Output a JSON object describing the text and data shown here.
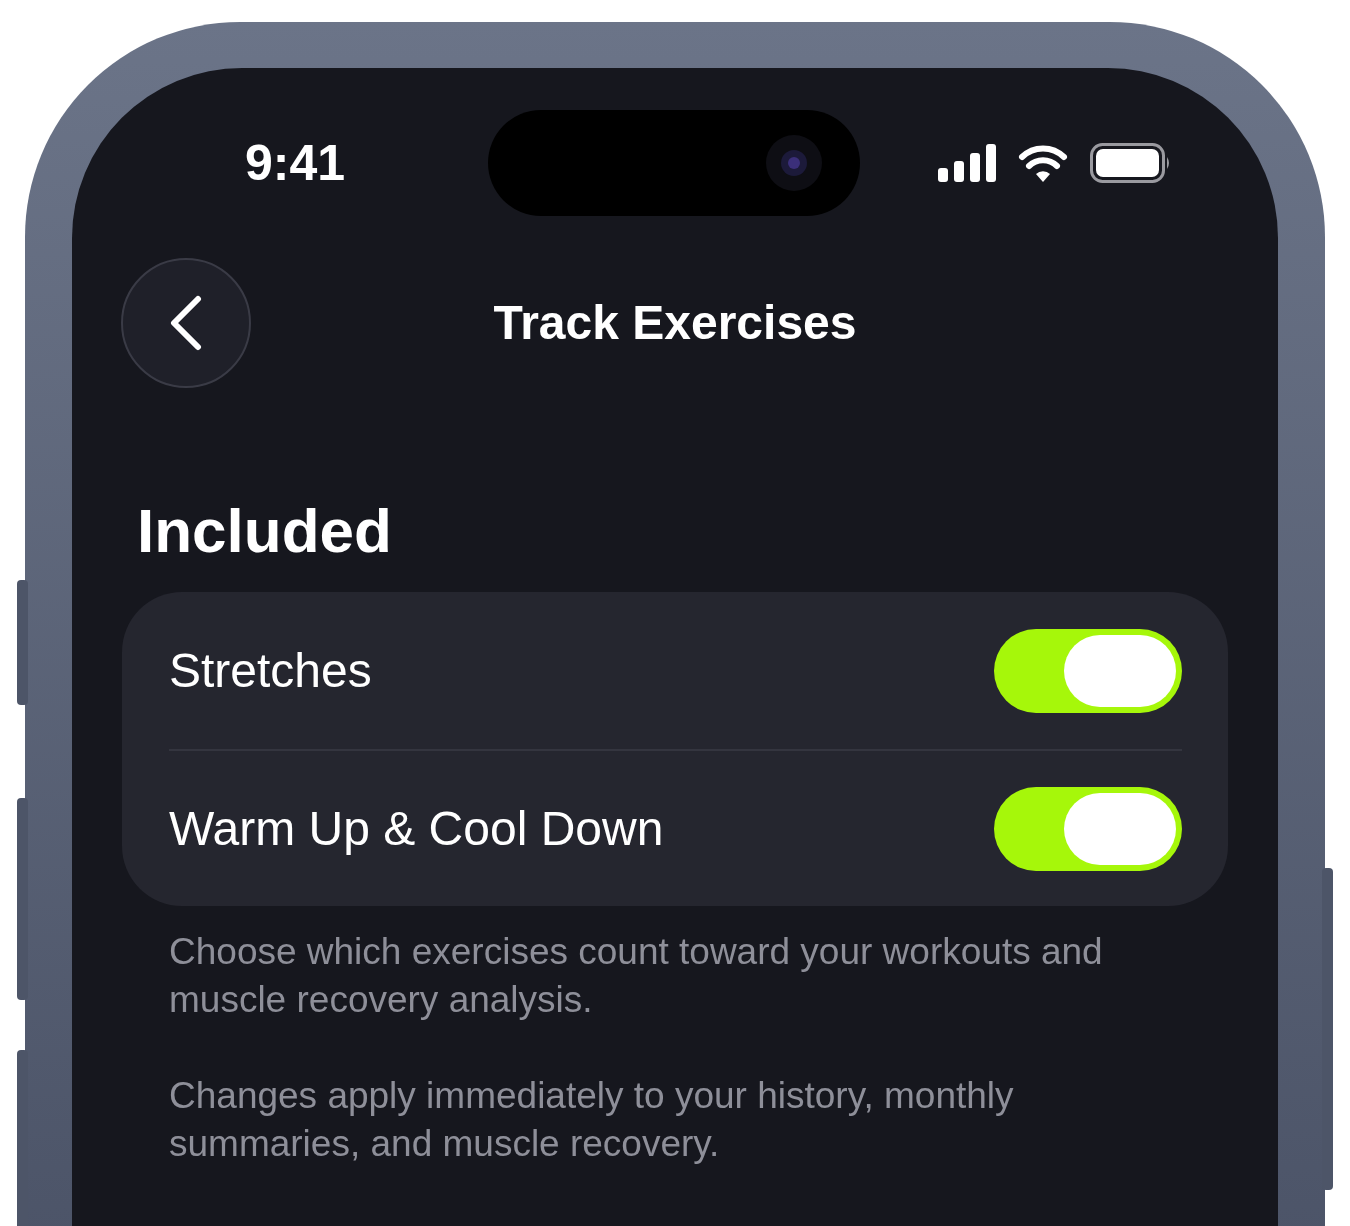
{
  "status_bar": {
    "time": "9:41"
  },
  "nav": {
    "title": "Track Exercises"
  },
  "section": {
    "title": "Included",
    "rows": [
      {
        "label": "Stretches",
        "on": true
      },
      {
        "label": "Warm Up & Cool Down",
        "on": true
      }
    ],
    "footer": [
      "Choose which exercises count toward your workouts and muscle recovery analysis.",
      "Changes apply immediately to your history, monthly summaries, and muscle recovery."
    ]
  }
}
